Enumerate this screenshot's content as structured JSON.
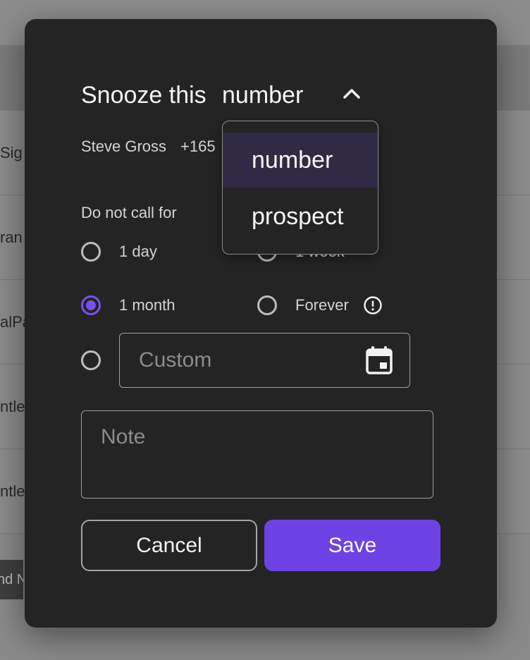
{
  "background": {
    "rows": [
      "Sig",
      "ran",
      "alPa",
      "ntle",
      "ntle"
    ],
    "pill": "nd N"
  },
  "modal": {
    "title": "Snooze this",
    "snooze_target": {
      "selected": "number",
      "options": [
        "number",
        "prospect"
      ]
    },
    "contact": {
      "name": "Steve Gross",
      "phone": "+165"
    },
    "duration_label": "Do not call for",
    "options": [
      {
        "label": "1 day",
        "checked": false
      },
      {
        "label": "1 week",
        "checked": false
      },
      {
        "label": "1 month",
        "checked": true
      },
      {
        "label": "Forever",
        "checked": false
      }
    ],
    "custom": {
      "placeholder": "Custom",
      "value": ""
    },
    "note": {
      "placeholder": "Note",
      "value": ""
    },
    "buttons": {
      "cancel": "Cancel",
      "save": "Save"
    }
  },
  "colors": {
    "accent": "#6d42e5",
    "modal_bg": "#242424",
    "dropdown_selected_bg": "#302a44"
  },
  "icons": {
    "chevron": "chevron-up-icon",
    "info": "info-icon",
    "calendar": "calendar-icon"
  }
}
